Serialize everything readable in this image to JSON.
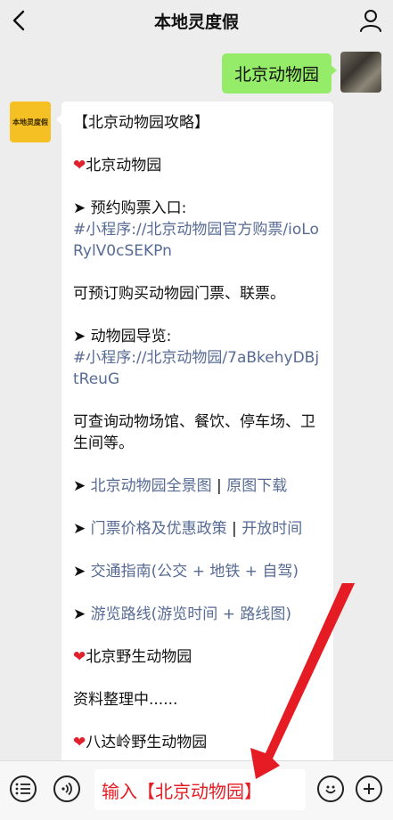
{
  "header": {
    "title": "本地灵度假",
    "back_icon": "chevron-left-icon",
    "profile_icon": "person-icon"
  },
  "outgoing": {
    "message": "北京动物园"
  },
  "bot": {
    "avatar_text": "本地灵度假"
  },
  "reply": {
    "title": "【北京动物园攻略】",
    "section1_heading": "北京动物园",
    "booking_label": "预约购票入口:",
    "booking_link": "#小程序://北京动物园官方购票/ioLoRylV0cSEKPn",
    "booking_desc": "可预订购买动物园门票、联票。",
    "guide_label": "动物园导览:",
    "guide_link": "#小程序://北京动物园/7aBkehyDBjtReuG",
    "guide_desc": "可查询动物场馆、餐饮、停车场、卫生间等。",
    "link_items": [
      {
        "a": "北京动物园全景图",
        "b": "原图下载"
      },
      {
        "a": "门票价格及优惠政策",
        "b": "开放时间"
      }
    ],
    "traffic": "交通指南(公交 + 地铁 + 自驾)",
    "route": "游览路线(游览时间 + 路线图)",
    "section2_heading": "北京野生动物园",
    "section2_desc": "资料整理中......",
    "section3_heading": "八达岭野生动物园"
  },
  "input": {
    "value": "输入【北京动物园】"
  },
  "colors": {
    "bubble_out": "#95ec69",
    "link": "#576b95",
    "annotation": "#e51c23"
  }
}
